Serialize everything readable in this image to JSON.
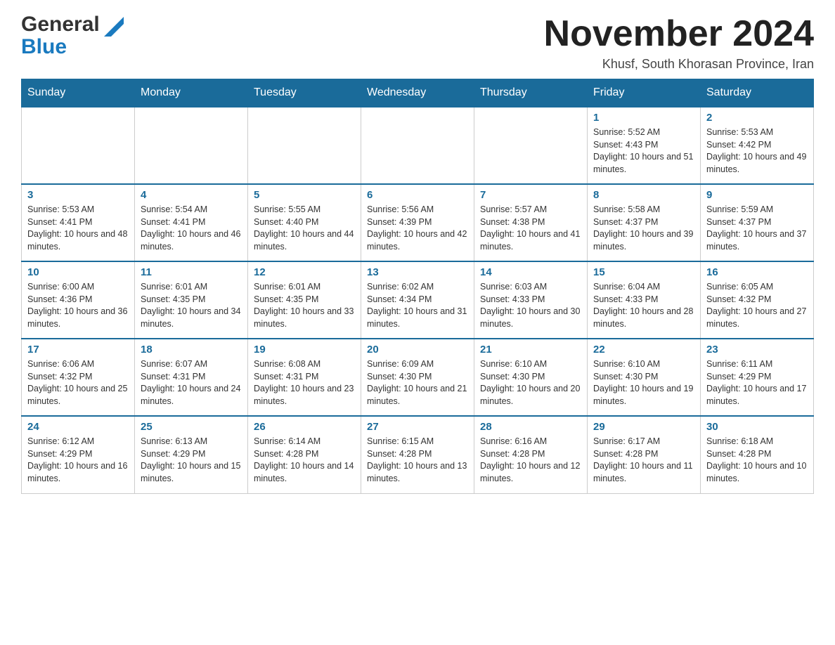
{
  "header": {
    "logo_general": "General",
    "logo_blue": "Blue",
    "title": "November 2024",
    "subtitle": "Khusf, South Khorasan Province, Iran"
  },
  "calendar": {
    "days_of_week": [
      "Sunday",
      "Monday",
      "Tuesday",
      "Wednesday",
      "Thursday",
      "Friday",
      "Saturday"
    ],
    "weeks": [
      [
        {
          "day": "",
          "info": ""
        },
        {
          "day": "",
          "info": ""
        },
        {
          "day": "",
          "info": ""
        },
        {
          "day": "",
          "info": ""
        },
        {
          "day": "",
          "info": ""
        },
        {
          "day": "1",
          "info": "Sunrise: 5:52 AM\nSunset: 4:43 PM\nDaylight: 10 hours and 51 minutes."
        },
        {
          "day": "2",
          "info": "Sunrise: 5:53 AM\nSunset: 4:42 PM\nDaylight: 10 hours and 49 minutes."
        }
      ],
      [
        {
          "day": "3",
          "info": "Sunrise: 5:53 AM\nSunset: 4:41 PM\nDaylight: 10 hours and 48 minutes."
        },
        {
          "day": "4",
          "info": "Sunrise: 5:54 AM\nSunset: 4:41 PM\nDaylight: 10 hours and 46 minutes."
        },
        {
          "day": "5",
          "info": "Sunrise: 5:55 AM\nSunset: 4:40 PM\nDaylight: 10 hours and 44 minutes."
        },
        {
          "day": "6",
          "info": "Sunrise: 5:56 AM\nSunset: 4:39 PM\nDaylight: 10 hours and 42 minutes."
        },
        {
          "day": "7",
          "info": "Sunrise: 5:57 AM\nSunset: 4:38 PM\nDaylight: 10 hours and 41 minutes."
        },
        {
          "day": "8",
          "info": "Sunrise: 5:58 AM\nSunset: 4:37 PM\nDaylight: 10 hours and 39 minutes."
        },
        {
          "day": "9",
          "info": "Sunrise: 5:59 AM\nSunset: 4:37 PM\nDaylight: 10 hours and 37 minutes."
        }
      ],
      [
        {
          "day": "10",
          "info": "Sunrise: 6:00 AM\nSunset: 4:36 PM\nDaylight: 10 hours and 36 minutes."
        },
        {
          "day": "11",
          "info": "Sunrise: 6:01 AM\nSunset: 4:35 PM\nDaylight: 10 hours and 34 minutes."
        },
        {
          "day": "12",
          "info": "Sunrise: 6:01 AM\nSunset: 4:35 PM\nDaylight: 10 hours and 33 minutes."
        },
        {
          "day": "13",
          "info": "Sunrise: 6:02 AM\nSunset: 4:34 PM\nDaylight: 10 hours and 31 minutes."
        },
        {
          "day": "14",
          "info": "Sunrise: 6:03 AM\nSunset: 4:33 PM\nDaylight: 10 hours and 30 minutes."
        },
        {
          "day": "15",
          "info": "Sunrise: 6:04 AM\nSunset: 4:33 PM\nDaylight: 10 hours and 28 minutes."
        },
        {
          "day": "16",
          "info": "Sunrise: 6:05 AM\nSunset: 4:32 PM\nDaylight: 10 hours and 27 minutes."
        }
      ],
      [
        {
          "day": "17",
          "info": "Sunrise: 6:06 AM\nSunset: 4:32 PM\nDaylight: 10 hours and 25 minutes."
        },
        {
          "day": "18",
          "info": "Sunrise: 6:07 AM\nSunset: 4:31 PM\nDaylight: 10 hours and 24 minutes."
        },
        {
          "day": "19",
          "info": "Sunrise: 6:08 AM\nSunset: 4:31 PM\nDaylight: 10 hours and 23 minutes."
        },
        {
          "day": "20",
          "info": "Sunrise: 6:09 AM\nSunset: 4:30 PM\nDaylight: 10 hours and 21 minutes."
        },
        {
          "day": "21",
          "info": "Sunrise: 6:10 AM\nSunset: 4:30 PM\nDaylight: 10 hours and 20 minutes."
        },
        {
          "day": "22",
          "info": "Sunrise: 6:10 AM\nSunset: 4:30 PM\nDaylight: 10 hours and 19 minutes."
        },
        {
          "day": "23",
          "info": "Sunrise: 6:11 AM\nSunset: 4:29 PM\nDaylight: 10 hours and 17 minutes."
        }
      ],
      [
        {
          "day": "24",
          "info": "Sunrise: 6:12 AM\nSunset: 4:29 PM\nDaylight: 10 hours and 16 minutes."
        },
        {
          "day": "25",
          "info": "Sunrise: 6:13 AM\nSunset: 4:29 PM\nDaylight: 10 hours and 15 minutes."
        },
        {
          "day": "26",
          "info": "Sunrise: 6:14 AM\nSunset: 4:28 PM\nDaylight: 10 hours and 14 minutes."
        },
        {
          "day": "27",
          "info": "Sunrise: 6:15 AM\nSunset: 4:28 PM\nDaylight: 10 hours and 13 minutes."
        },
        {
          "day": "28",
          "info": "Sunrise: 6:16 AM\nSunset: 4:28 PM\nDaylight: 10 hours and 12 minutes."
        },
        {
          "day": "29",
          "info": "Sunrise: 6:17 AM\nSunset: 4:28 PM\nDaylight: 10 hours and 11 minutes."
        },
        {
          "day": "30",
          "info": "Sunrise: 6:18 AM\nSunset: 4:28 PM\nDaylight: 10 hours and 10 minutes."
        }
      ]
    ]
  }
}
